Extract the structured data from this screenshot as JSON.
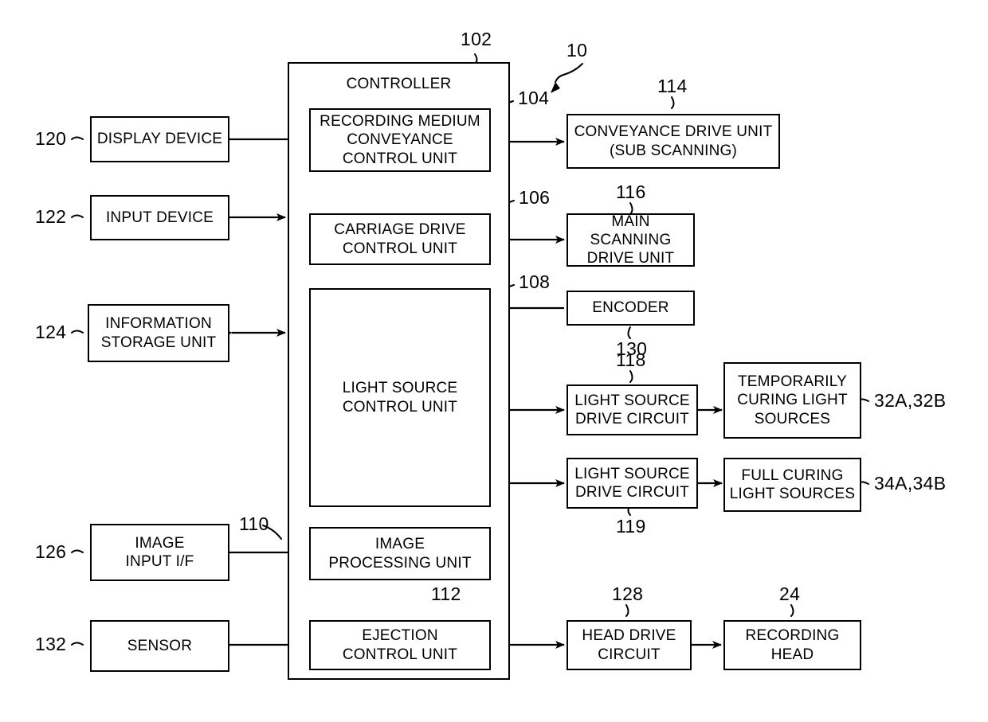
{
  "figure": {
    "type": "patent-block-diagram",
    "system_ref": "10",
    "background": "#ffffff",
    "line_color": "#000000"
  },
  "controller": {
    "title": "CONTROLLER",
    "ref": "102",
    "units": [
      {
        "ref": "104",
        "label": "RECORDING MEDIUM\nCONVEYANCE\nCONTROL UNIT"
      },
      {
        "ref": "106",
        "label": "CARRIAGE DRIVE\nCONTROL UNIT"
      },
      {
        "ref": "108",
        "label": "LIGHT SOURCE\nCONTROL UNIT"
      },
      {
        "ref": "110",
        "label": "IMAGE\nPROCESSING UNIT"
      },
      {
        "ref": "112",
        "label": "EJECTION\nCONTROL UNIT"
      }
    ]
  },
  "left_blocks": [
    {
      "ref": "120",
      "label": "DISPLAY DEVICE"
    },
    {
      "ref": "122",
      "label": "INPUT DEVICE"
    },
    {
      "ref": "124",
      "label": "INFORMATION\nSTORAGE UNIT"
    },
    {
      "ref": "126",
      "label": "IMAGE\nINPUT I/F"
    },
    {
      "ref": "132",
      "label": "SENSOR"
    }
  ],
  "right_blocks": [
    {
      "ref": "114",
      "label": "CONVEYANCE DRIVE UNIT\n(SUB SCANNING)"
    },
    {
      "ref": "116",
      "label": "MAIN SCANNING\nDRIVE UNIT"
    },
    {
      "ref": "130",
      "label": "ENCODER"
    },
    {
      "ref": "118",
      "label": "LIGHT SOURCE\nDRIVE CIRCUIT"
    },
    {
      "ref": "119",
      "label": "LIGHT SOURCE\nDRIVE CIRCUIT"
    },
    {
      "ref": "128",
      "label": "HEAD DRIVE\nCIRCUIT"
    }
  ],
  "far_right_blocks": [
    {
      "ref": "32A,32B",
      "label": "TEMPORARILY\nCURING LIGHT\nSOURCES"
    },
    {
      "ref": "34A,34B",
      "label": "FULL CURING\nLIGHT SOURCES"
    },
    {
      "ref": "24",
      "label": "RECORDING\nHEAD"
    }
  ]
}
